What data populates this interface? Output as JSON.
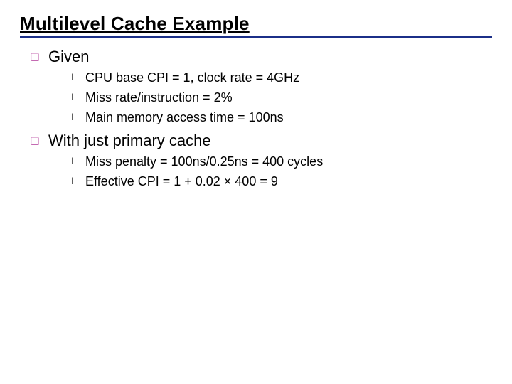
{
  "title": "Multilevel Cache Example",
  "sections": [
    {
      "label": "Given",
      "items": [
        "CPU base CPI = 1, clock rate = 4GHz",
        "Miss rate/instruction = 2%",
        "Main memory access time = 100ns"
      ]
    },
    {
      "label": "With just primary cache",
      "items": [
        "Miss penalty = 100ns/0.25ns = 400 cycles",
        "Effective CPI = 1 + 0.02 × 400 = 9"
      ]
    }
  ],
  "bullets": {
    "square": "❑",
    "sub": "l"
  }
}
